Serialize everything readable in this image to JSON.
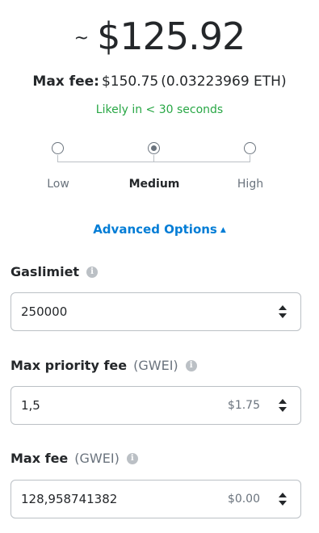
{
  "estimate": {
    "tilde": "~",
    "amount": "$125.92"
  },
  "max_fee_summary": {
    "label": "Max fee:",
    "fiat": "$150.75",
    "eth": "(0.03223969 ETH)"
  },
  "likely": "Likely in < 30 seconds",
  "levels": [
    {
      "label": "Low",
      "selected": false
    },
    {
      "label": "Medium",
      "selected": true
    },
    {
      "label": "High",
      "selected": false
    }
  ],
  "advanced": {
    "label": "Advanced Options",
    "expanded": true
  },
  "fields": {
    "gas_limit": {
      "label": "Gaslimiet",
      "value": "250000"
    },
    "priority_fee": {
      "label": "Max priority fee",
      "unit": "(GWEI)",
      "value": "1,5",
      "fiat": "$1.75"
    },
    "max_fee": {
      "label": "Max fee",
      "unit": "(GWEI)",
      "value": "128,958741382",
      "fiat": "$0.00"
    }
  },
  "colors": {
    "accent": "#037dd6",
    "success": "#28a745",
    "text": "#24272a",
    "muted": "#6a737d",
    "border": "#bbc0c5"
  },
  "icons": [
    "info-icon",
    "caret-up-icon",
    "stepper-icon"
  ]
}
